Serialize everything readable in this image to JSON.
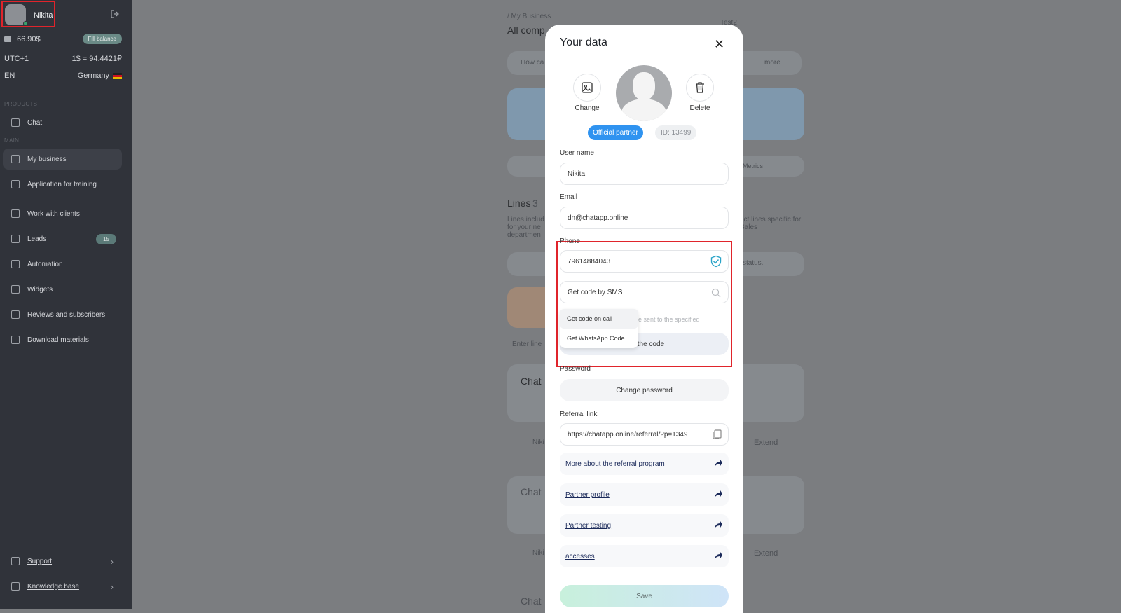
{
  "sidebar": {
    "user_name": "Nikita",
    "balance": "66.90$",
    "fill_balance": "Fill balance",
    "timezone": "UTC+1",
    "rate": "1$ = 94.4421₽",
    "lang": "EN",
    "country": "Germany",
    "section_products": "PRODUCTS",
    "section_main": "MAIN",
    "items": [
      {
        "label": "Chat"
      },
      {
        "label": "My business"
      },
      {
        "label": "Application for training"
      },
      {
        "label": "Work with clients"
      },
      {
        "label": "Leads",
        "count": "15"
      },
      {
        "label": "Automation"
      },
      {
        "label": "Widgets"
      },
      {
        "label": "Reviews and subscribers"
      },
      {
        "label": "Download materials"
      }
    ],
    "support": "Support",
    "knowledge": "Knowledge base"
  },
  "background": {
    "breadcrumb": "/ My Business",
    "heading": "All comp",
    "dropdown": "Test2",
    "banner_text": "How ca",
    "more": "more",
    "metrics": "Metrics",
    "lines_title": "Lines",
    "lines_count": "3",
    "lines_desc_left": "Lines includ for your ne departmen",
    "lines_desc_right": "ect lines specific for Sales",
    "status": "status.",
    "enter_line": "Enter line",
    "chat1": "Chat",
    "user1": "Niki",
    "extend1": "Extend",
    "chat2": "Chat",
    "user2": "Niki",
    "extend2": "Extend",
    "chat3": "Chat"
  },
  "modal": {
    "title": "Your data",
    "change": "Change",
    "delete": "Delete",
    "official_partner": "Official partner",
    "id": "ID: 13499",
    "username_label": "User name",
    "username_value": "Nikita",
    "email_label": "Email",
    "email_value": "dn@chatapp.online",
    "phone_label": "Phone",
    "phone_value": "79614884043",
    "sms_value": "Get code by SMS",
    "dropdown_options": [
      "Get code on call",
      "Get WhatsApp Code"
    ],
    "hint": "be sent to the specified",
    "get_code": "Get the code",
    "password_label": "Password",
    "change_password": "Change password",
    "referral_label": "Referral link",
    "referral_value": "https://chatapp.online/referral/?p=1349",
    "links": [
      "More about the referral program",
      "Partner profile",
      "Partner testing",
      "accesses"
    ],
    "save": "Save"
  }
}
